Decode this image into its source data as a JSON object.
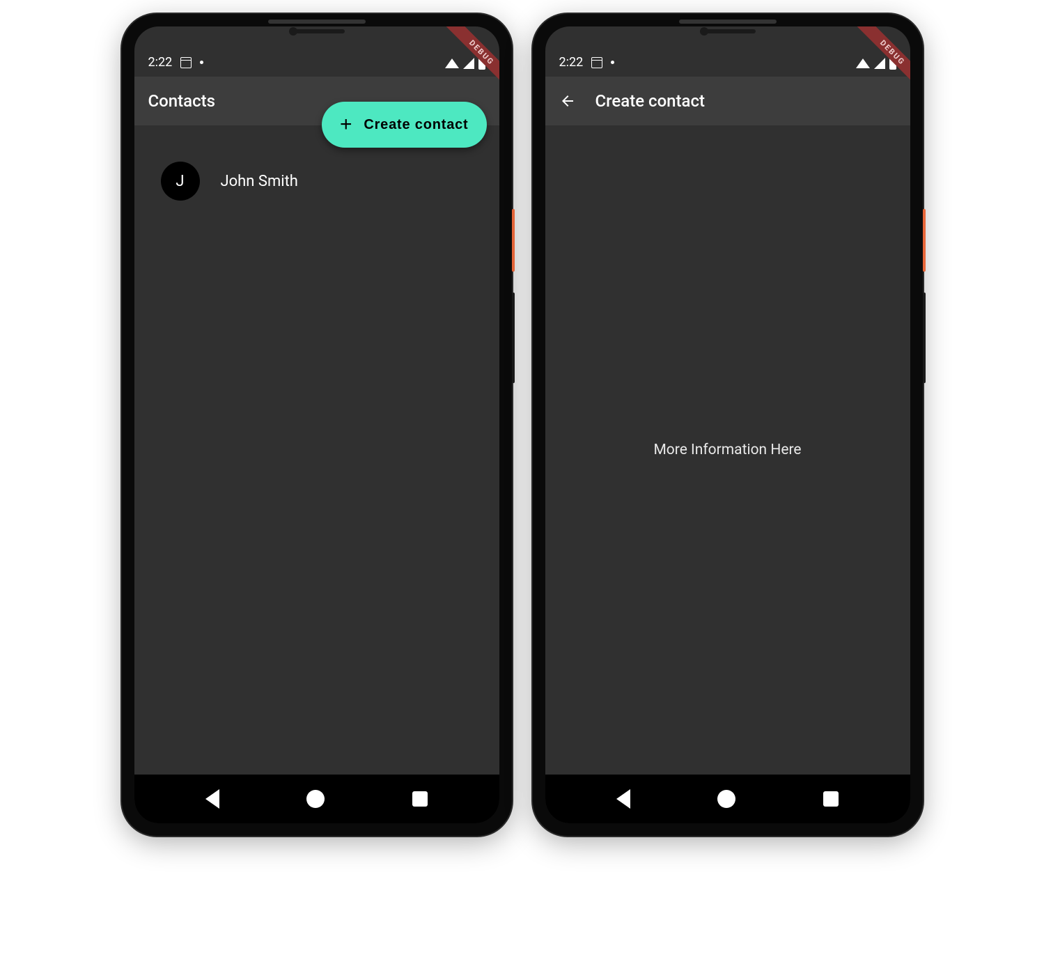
{
  "status": {
    "time": "2:22"
  },
  "debug_label": "DEBUG",
  "screen1": {
    "title": "Contacts",
    "fab_label": "Create contact",
    "contacts": [
      {
        "initial": "J",
        "name": "John Smith"
      }
    ]
  },
  "screen2": {
    "title": "Create contact",
    "body_text": "More Information Here"
  }
}
